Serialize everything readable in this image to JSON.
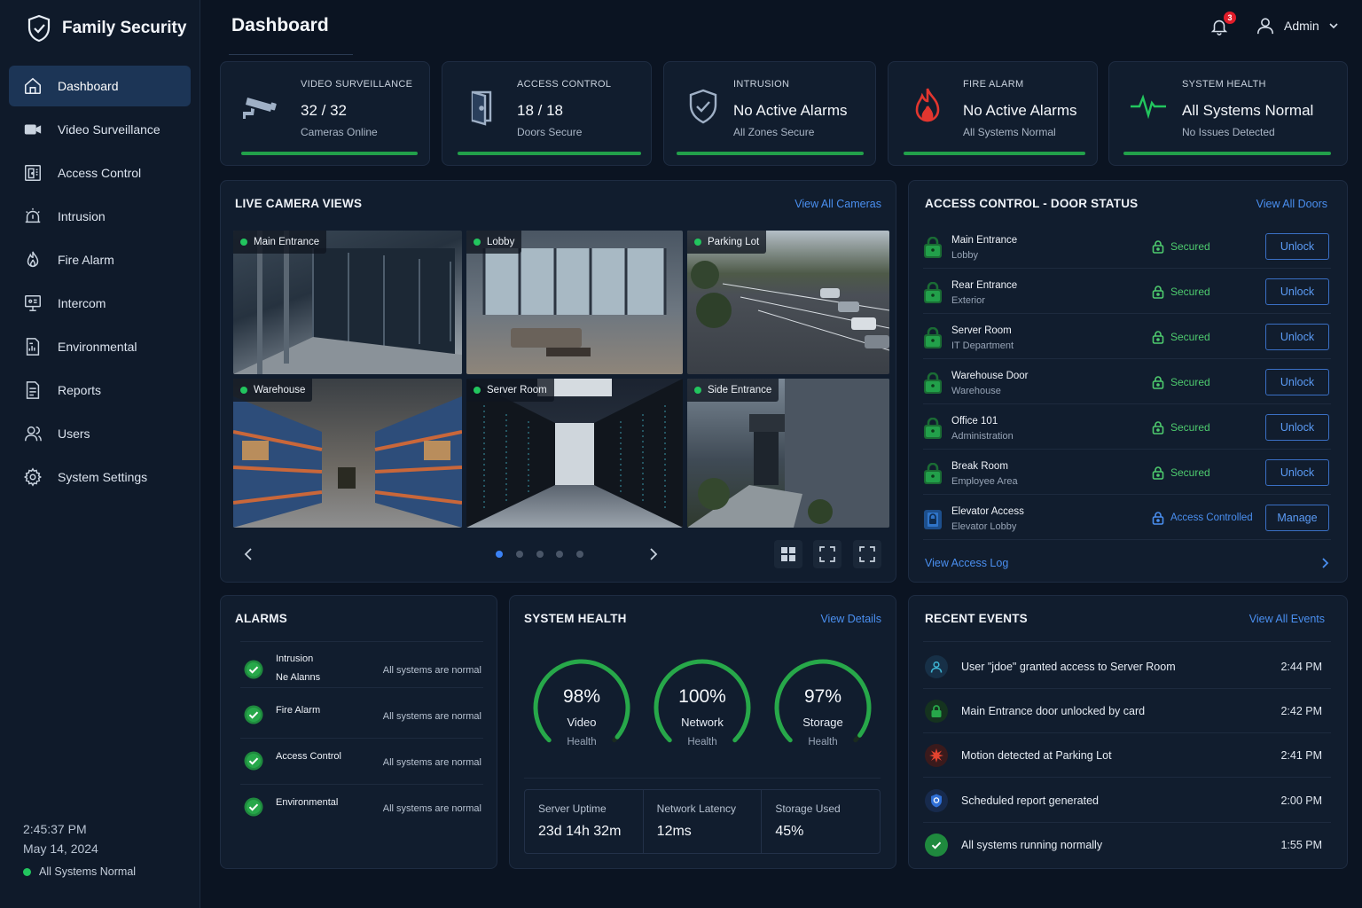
{
  "brand": {
    "name": "Family Security"
  },
  "sidebar": {
    "items": [
      {
        "label": "Dashboard",
        "icon": "home-icon"
      },
      {
        "label": "Video Surveillance",
        "icon": "camera-icon"
      },
      {
        "label": "Access Control",
        "icon": "door-icon"
      },
      {
        "label": "Intrusion",
        "icon": "alarm-icon"
      },
      {
        "label": "Fire Alarm",
        "icon": "flame-icon"
      },
      {
        "label": "Intercom",
        "icon": "intercom-icon"
      },
      {
        "label": "Environmental",
        "icon": "document-chart-icon"
      },
      {
        "label": "Reports",
        "icon": "report-icon"
      },
      {
        "label": "Users",
        "icon": "users-icon"
      },
      {
        "label": "System Settings",
        "icon": "gear-icon"
      }
    ],
    "footer": {
      "time": "2:45:37 PM",
      "date": "May 14, 2024",
      "status": "All Systems Normal"
    }
  },
  "header": {
    "title": "Dashboard",
    "notifications": "3",
    "user": "Admin"
  },
  "stats": [
    {
      "label": "VIDEO SURVEILLANCE",
      "value": "32 / 32",
      "sub": "Cameras Online",
      "icon": "cctv-icon"
    },
    {
      "label": "ACCESS CONTROL",
      "value": "18 / 18",
      "sub": "Doors Secure",
      "icon": "door-icon"
    },
    {
      "label": "INTRUSION",
      "value": "No Active Alarms",
      "sub": "All Zones Secure",
      "icon": "shield-check-icon"
    },
    {
      "label": "FIRE ALARM",
      "value": "No Active Alarms",
      "sub": "All Systems Normal",
      "icon": "flame-icon"
    },
    {
      "label": "SYSTEM HEALTH",
      "value": "All Systems Normal",
      "sub": "No Issues Detected",
      "icon": "pulse-icon"
    }
  ],
  "cameras": {
    "title": "LIVE CAMERA VIEWS",
    "link": "View All Cameras",
    "feeds": [
      "Main Entrance",
      "Lobby",
      "Parking Lot",
      "Warehouse",
      "Server Room",
      "Side Entrance"
    ],
    "page": 1,
    "pages": 5
  },
  "doors": {
    "title": "ACCESS CONTROL - DOOR STATUS",
    "link": "View All Doors",
    "rows": [
      {
        "name": "Main Entrance",
        "location": "Lobby",
        "status": "Secured",
        "action": "Unlock"
      },
      {
        "name": "Rear Entrance",
        "location": "Exterior",
        "status": "Secured",
        "action": "Unlock"
      },
      {
        "name": "Server Room",
        "location": "IT Department",
        "status": "Secured",
        "action": "Unlock"
      },
      {
        "name": "Warehouse Door",
        "location": "Warehouse",
        "status": "Secured",
        "action": "Unlock"
      },
      {
        "name": "Office 101",
        "location": "Administration",
        "status": "Secured",
        "action": "Unlock"
      },
      {
        "name": "Break Room",
        "location": "Employee Area",
        "status": "Secured",
        "action": "Unlock"
      },
      {
        "name": "Elevator Access",
        "location": "Elevator Lobby",
        "status": "Access Controlled",
        "action": "Manage"
      }
    ],
    "footer_link": "View Access Log"
  },
  "alarms": {
    "title": "ALARMS",
    "rows": [
      {
        "name": "Intrusion",
        "name2": "Ne Alanns",
        "message": "All systems are normal"
      },
      {
        "name": "Fire Alarm",
        "message": "All systems are normal"
      },
      {
        "name": "Access Control",
        "message": "All systems are normal"
      },
      {
        "name": "Environmental",
        "message": "All systems are normal"
      }
    ]
  },
  "health": {
    "title": "SYSTEM HEALTH",
    "link": "View Details",
    "gauges": [
      {
        "pct": "98%",
        "value": 98,
        "name": "Video",
        "sub": "Health"
      },
      {
        "pct": "100%",
        "value": 100,
        "name": "Network",
        "sub": "Health"
      },
      {
        "pct": "97%",
        "value": 97,
        "name": "Storage",
        "sub": "Health"
      }
    ],
    "metrics": [
      {
        "label": "Server Uptime",
        "value": "23d 14h 32m"
      },
      {
        "label": "Network Latency",
        "value": "12ms"
      },
      {
        "label": "Storage Used",
        "value": "45%"
      }
    ]
  },
  "events": {
    "title": "RECENT EVENTS",
    "link": "View All Events",
    "rows": [
      {
        "text": "User \"jdoe\" granted access to Server Room",
        "time": "2:44 PM",
        "icon": "user-icon"
      },
      {
        "text": "Main Entrance door unlocked by card",
        "time": "2:42 PM",
        "icon": "lock-icon"
      },
      {
        "text": "Motion detected at Parking Lot",
        "time": "2:41 PM",
        "icon": "motion-icon"
      },
      {
        "text": "Scheduled report generated",
        "time": "2:00 PM",
        "icon": "report-badge-icon"
      },
      {
        "text": "All systems running normally",
        "time": "1:55 PM",
        "icon": "check-icon"
      }
    ]
  },
  "colors": {
    "accent": "#3b82f6",
    "success": "#22c55e",
    "panel": "#111d2e",
    "background": "#0b1422",
    "alert": "#e11d2a"
  }
}
